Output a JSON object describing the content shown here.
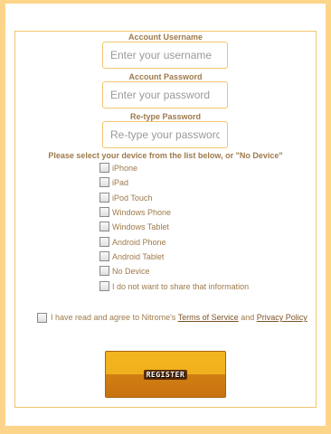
{
  "form": {
    "username_label": "Account Username",
    "username_placeholder": "Enter your username",
    "password_label": "Account Password",
    "password_placeholder": "Enter your password",
    "retype_label": "Re-type Password",
    "retype_placeholder": "Re-type your password",
    "device_heading": "Please select your device from the list below, or \"No Device\"",
    "devices": [
      "iPhone",
      "iPad",
      "iPod Touch",
      "Windows Phone",
      "Windows Tablet",
      "Android Phone",
      "Android Tablet",
      "No Device",
      "I do not want to share that information"
    ],
    "terms_prefix": "I have read and agree to Nitrome's",
    "terms_of_service": "Terms of Service",
    "terms_and": "and",
    "privacy_policy": "Privacy Policy",
    "register_label": "REGISTER"
  },
  "colors": {
    "frame": "#fcd58b",
    "label_text": "#9e7a4b",
    "button_top": "#f2b520",
    "button_bottom": "#c8720f"
  }
}
